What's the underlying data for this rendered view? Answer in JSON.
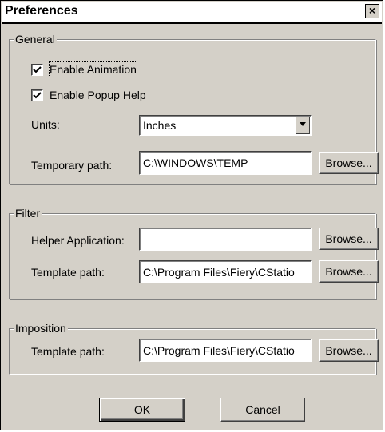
{
  "window": {
    "title": "Preferences",
    "close_glyph": "×"
  },
  "general": {
    "label": "General",
    "enable_animation": {
      "label": "Enable Animation",
      "checked": true
    },
    "enable_popup_help": {
      "label": "Enable Popup Help",
      "checked": true
    },
    "units": {
      "label": "Units:",
      "value": "Inches"
    },
    "temp_path": {
      "label": "Temporary path:",
      "value": "C:\\WINDOWS\\TEMP",
      "browse": "Browse..."
    }
  },
  "filter": {
    "label": "Filter",
    "helper_app": {
      "label": "Helper Application:",
      "value": "",
      "browse": "Browse..."
    },
    "template_path": {
      "label": "Template path:",
      "value": "C:\\Program Files\\Fiery\\CStatio",
      "browse": "Browse..."
    }
  },
  "imposition": {
    "label": "Imposition",
    "template_path": {
      "label": "Template path:",
      "value": "C:\\Program Files\\Fiery\\CStatio",
      "browse": "Browse..."
    }
  },
  "footer": {
    "ok": "OK",
    "cancel": "Cancel"
  },
  "icons": {
    "checkmark": "check-icon",
    "dropdown": "chevron-down-icon",
    "close": "close-icon"
  },
  "colors": {
    "face": "#d4d0c8",
    "shadow": "#808080",
    "highlight": "#ffffff"
  }
}
